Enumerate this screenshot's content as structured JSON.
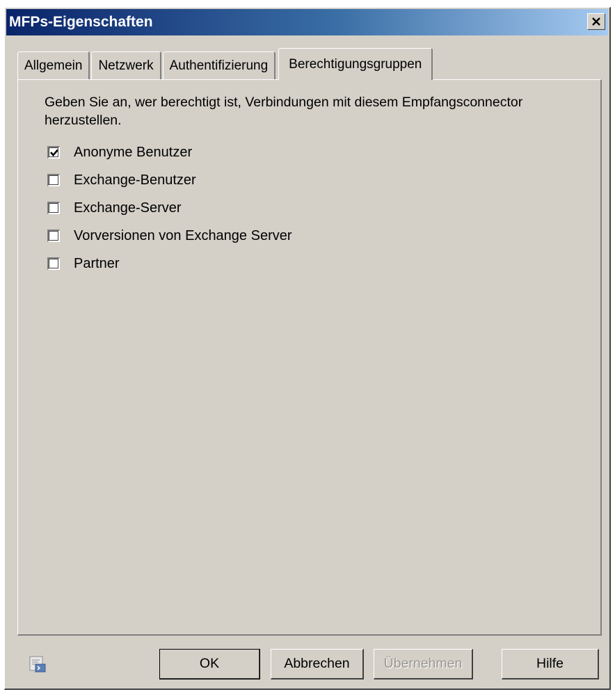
{
  "window": {
    "title": "MFPs-Eigenschaften"
  },
  "tabs": [
    {
      "label": "Allgemein",
      "active": false
    },
    {
      "label": "Netzwerk",
      "active": false
    },
    {
      "label": "Authentifizierung",
      "active": false
    },
    {
      "label": "Berechtigungsgruppen",
      "active": true
    }
  ],
  "panel": {
    "description": "Geben Sie an, wer berechtigt ist, Verbindungen mit diesem Empfangsconnector herzustellen.",
    "options": [
      {
        "label": "Anonyme Benutzer",
        "checked": true
      },
      {
        "label": "Exchange-Benutzer",
        "checked": false
      },
      {
        "label": "Exchange-Server",
        "checked": false
      },
      {
        "label": "Vorversionen von Exchange Server",
        "checked": false
      },
      {
        "label": "Partner",
        "checked": false
      }
    ]
  },
  "buttons": {
    "ok": "OK",
    "cancel": "Abbrechen",
    "apply": "Übernehmen",
    "help": "Hilfe"
  },
  "icons": {
    "close": "close-icon",
    "powershell": "powershell-icon"
  }
}
